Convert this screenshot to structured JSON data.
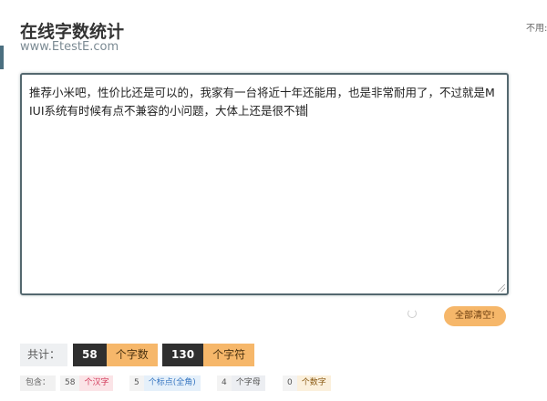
{
  "header": {
    "title": "在线字数统计",
    "subtitle": "www.EtestE.com",
    "side_note": "不用:"
  },
  "editor": {
    "text": "推荐小米吧，性价比还是可以的，我家有一台将近十年还能用，也是非常耐用了，不过就是MIUI系统有时候有点不兼容的小问题，大体上还是很不错"
  },
  "actions": {
    "clear_label": "全部清空!"
  },
  "stats": {
    "total_label": "共计：",
    "hanzi_count": "58",
    "hanzi_unit": "个字数",
    "char_count": "130",
    "char_unit": "个字符"
  },
  "breakdown": {
    "label": "包含：",
    "hanzi_count": "58",
    "hanzi_unit": "个汉字",
    "punct_count": "5",
    "punct_unit": "个标点(全角)",
    "letter_count": "4",
    "letter_unit": "个字母",
    "digit_count": "0",
    "digit_unit": "个数字"
  },
  "colors": {
    "accent_orange": "#f6b76a",
    "dark_badge": "#2f2f2f",
    "editor_border": "#54686f"
  }
}
